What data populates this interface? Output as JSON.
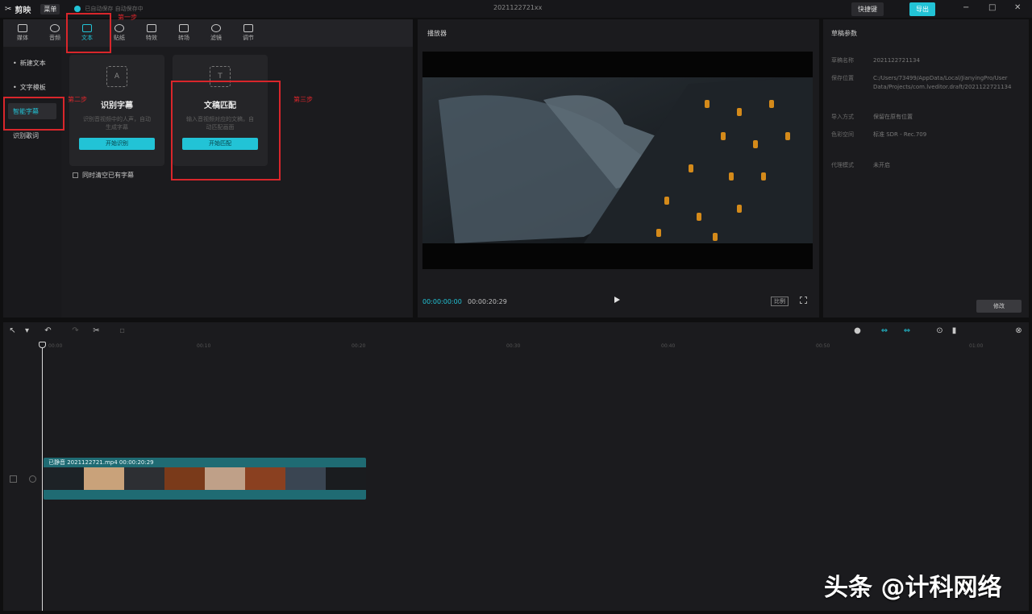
{
  "titlebar": {
    "app_name": "剪映",
    "menu_label": "菜单",
    "autosave": "已自动保存 自动保存中",
    "doc_title": "2021122721xx",
    "shortcut_label": "快捷键",
    "export_label": "导出",
    "minimize": "−",
    "maximize": "□",
    "close": "✕"
  },
  "tool_tabs": [
    {
      "label": "媒体"
    },
    {
      "label": "音频"
    },
    {
      "label": "文本"
    },
    {
      "label": "贴纸"
    },
    {
      "label": "特效"
    },
    {
      "label": "转场"
    },
    {
      "label": "滤镜"
    },
    {
      "label": "调节"
    }
  ],
  "sidebar": {
    "items": [
      {
        "label": "新建文本"
      },
      {
        "label": "文字模板"
      },
      {
        "label": "智能字幕"
      },
      {
        "label": "识别歌词"
      }
    ]
  },
  "cards": {
    "recognize": {
      "title": "识别字幕",
      "desc": "识别音视频中的人声，自动生成字幕",
      "button": "开始识别"
    },
    "match": {
      "title": "文稿匹配",
      "desc": "输入音视频对应的文稿，自动匹配画面",
      "button": "开始匹配"
    },
    "bilingual": "同时清空已有字幕"
  },
  "annotations": {
    "step1": "第一步",
    "step2": "第二步",
    "step3": "第三步"
  },
  "player": {
    "title": "播放器",
    "current_time": "00:00:00:00",
    "total_time": "00:00:20:29",
    "ratio_label": "比例"
  },
  "draft": {
    "title": "草稿参数",
    "rows": [
      {
        "key": "草稿名称",
        "value": "2021122721134"
      },
      {
        "key": "保存位置",
        "value": "C:/Users/73499/AppData/Local/JianyingPro/User Data/Projects/com.lveditor.draft/2021122721134"
      },
      {
        "key": "导入方式",
        "value": "保留在原有位置"
      },
      {
        "key": "色彩空间",
        "value": "标准 SDR - Rec.709"
      },
      {
        "key": "代理模式",
        "value": "未开启"
      }
    ],
    "modify_label": "修改"
  },
  "timeline": {
    "ruler_ticks": [
      "00:00",
      "00:10",
      "00:20",
      "00:30",
      "00:40",
      "00:50",
      "01:00"
    ],
    "clip_label": "已静音  2021122721.mp4  00:00:20:29"
  },
  "watermark": "头条 @计科网络"
}
